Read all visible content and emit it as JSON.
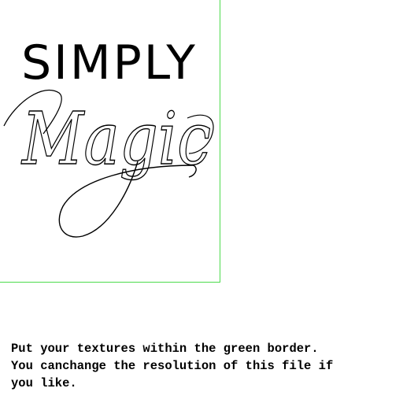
{
  "texture": {
    "border_color": "#4cdb4c",
    "logo": {
      "word_top": "SIMPLY",
      "word_bottom": "Magic",
      "ink_color": "#000000"
    }
  },
  "instructions": {
    "line1": "Put your textures within the green border.",
    "line2": "You canchange the resolution of this file if",
    "line3": "you like."
  }
}
